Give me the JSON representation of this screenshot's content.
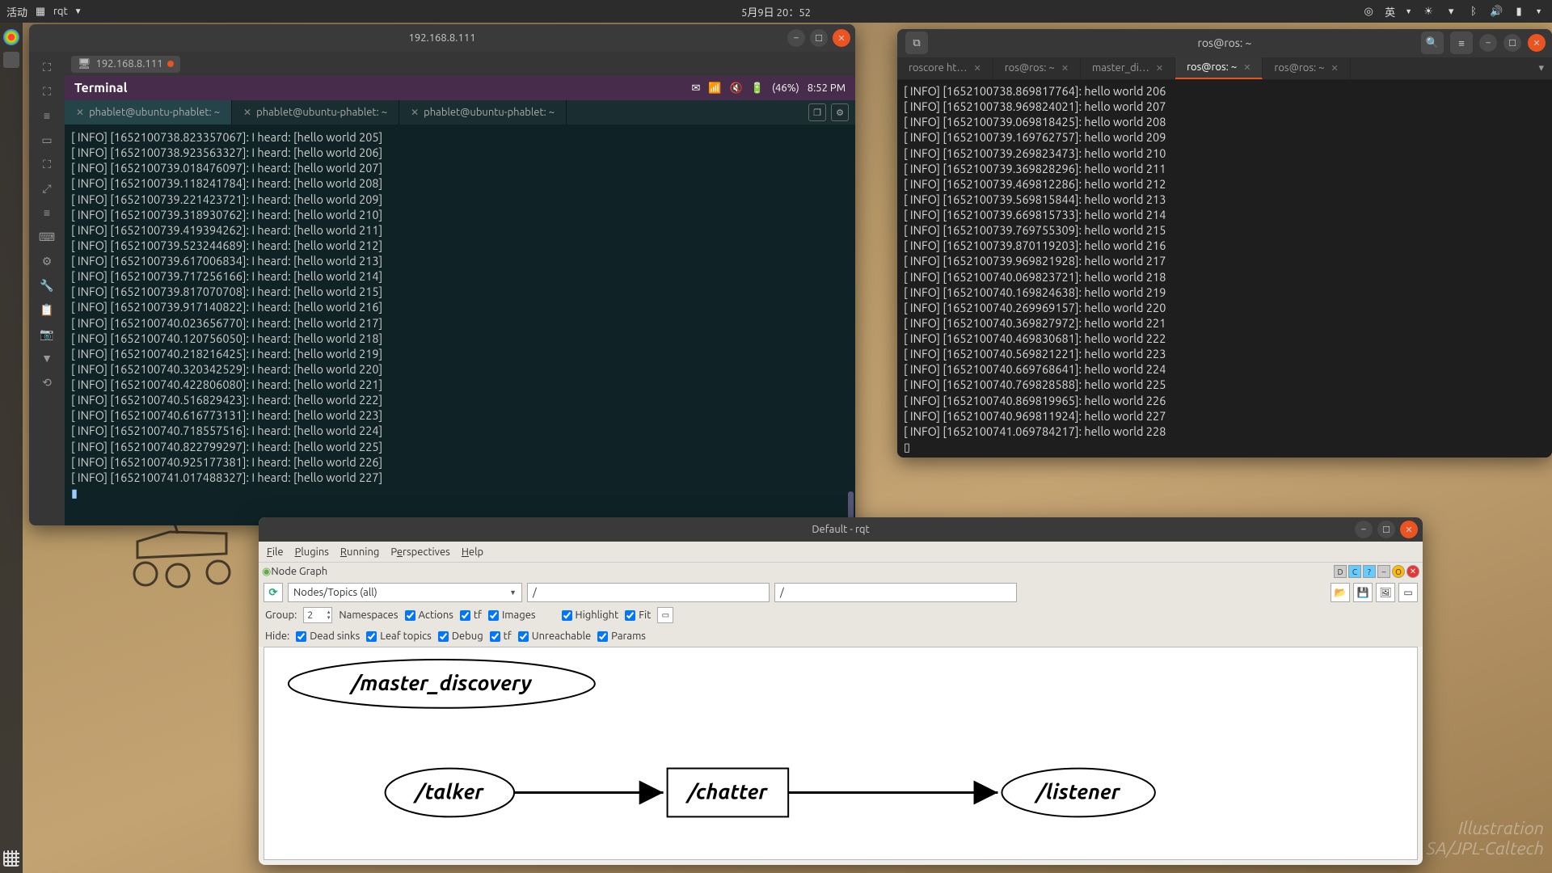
{
  "topbar": {
    "activities": "活动",
    "app": "rqt",
    "datetime": "5月9日 20：52",
    "lang": "英"
  },
  "dock_items": [
    "chrome",
    "google",
    "item3",
    "item4",
    "item5",
    "item6",
    "item7",
    "item8",
    "item9",
    "item10",
    "item11",
    "item12",
    "item13",
    "item14",
    "item15",
    "item16"
  ],
  "win1": {
    "title": "192.168.8.111",
    "tab_label": "192.168.8.111",
    "terminal_title": "Terminal",
    "battery": "(46%)",
    "time": "8:52 PM",
    "tabs": [
      "phablet@ubuntu-phablet: ~",
      "phablet@ubuntu-phablet: ~",
      "phablet@ubuntu-phablet: ~"
    ],
    "lines": [
      "[ INFO] [1652100738.823357067]: I heard: [hello world 205]",
      "[ INFO] [1652100738.923563327]: I heard: [hello world 206]",
      "[ INFO] [1652100739.018476097]: I heard: [hello world 207]",
      "[ INFO] [1652100739.118241784]: I heard: [hello world 208]",
      "[ INFO] [1652100739.221423721]: I heard: [hello world 209]",
      "[ INFO] [1652100739.318930762]: I heard: [hello world 210]",
      "[ INFO] [1652100739.419394262]: I heard: [hello world 211]",
      "[ INFO] [1652100739.523244689]: I heard: [hello world 212]",
      "[ INFO] [1652100739.617006834]: I heard: [hello world 213]",
      "[ INFO] [1652100739.717256166]: I heard: [hello world 214]",
      "[ INFO] [1652100739.817070708]: I heard: [hello world 215]",
      "[ INFO] [1652100739.917140822]: I heard: [hello world 216]",
      "[ INFO] [1652100740.023656770]: I heard: [hello world 217]",
      "[ INFO] [1652100740.120756050]: I heard: [hello world 218]",
      "[ INFO] [1652100740.218216425]: I heard: [hello world 219]",
      "[ INFO] [1652100740.320342529]: I heard: [hello world 220]",
      "[ INFO] [1652100740.422806080]: I heard: [hello world 221]",
      "[ INFO] [1652100740.516829423]: I heard: [hello world 222]",
      "[ INFO] [1652100740.616773131]: I heard: [hello world 223]",
      "[ INFO] [1652100740.718557516]: I heard: [hello world 224]",
      "[ INFO] [1652100740.822799297]: I heard: [hello world 225]",
      "[ INFO] [1652100740.925177381]: I heard: [hello world 226]",
      "[ INFO] [1652100741.017488327]: I heard: [hello world 227]"
    ]
  },
  "win2": {
    "title": "ros@ros: ~",
    "tabs": [
      "roscore ht…",
      "ros@ros: ~",
      "master_di…",
      "ros@ros: ~",
      "ros@ros: ~"
    ],
    "active_tab": 3,
    "lines": [
      "[ INFO] [1652100738.869817764]: hello world 206",
      "[ INFO] [1652100738.969824021]: hello world 207",
      "[ INFO] [1652100739.069818425]: hello world 208",
      "[ INFO] [1652100739.169762757]: hello world 209",
      "[ INFO] [1652100739.269823473]: hello world 210",
      "[ INFO] [1652100739.369828296]: hello world 211",
      "[ INFO] [1652100739.469812286]: hello world 212",
      "[ INFO] [1652100739.569815844]: hello world 213",
      "[ INFO] [1652100739.669815733]: hello world 214",
      "[ INFO] [1652100739.769755309]: hello world 215",
      "[ INFO] [1652100739.870119203]: hello world 216",
      "[ INFO] [1652100739.969821928]: hello world 217",
      "[ INFO] [1652100740.069823721]: hello world 218",
      "[ INFO] [1652100740.169824638]: hello world 219",
      "[ INFO] [1652100740.269969157]: hello world 220",
      "[ INFO] [1652100740.369827972]: hello world 221",
      "[ INFO] [1652100740.469830681]: hello world 222",
      "[ INFO] [1652100740.569821221]: hello world 223",
      "[ INFO] [1652100740.669768641]: hello world 224",
      "[ INFO] [1652100740.769828588]: hello world 225",
      "[ INFO] [1652100740.869819965]: hello world 226",
      "[ INFO] [1652100740.969811924]: hello world 227",
      "[ INFO] [1652100741.069784217]: hello world 228"
    ]
  },
  "win3": {
    "title": "Default - rqt",
    "menu": [
      "File",
      "Plugins",
      "Running",
      "Perspectives",
      "Help"
    ],
    "subtitle": "Node Graph",
    "combo": "Nodes/Topics (all)",
    "filter1": "/",
    "filter2": "/",
    "group_label": "Group:",
    "group_val": "2",
    "checks1": [
      "Namespaces",
      "Actions",
      "tf",
      "Images",
      "Highlight",
      "Fit"
    ],
    "hide_label": "Hide:",
    "checks2": [
      "Dead sinks",
      "Leaf topics",
      "Debug",
      "tf",
      "Unreachable",
      "Params"
    ],
    "nodes": {
      "a": "/master_discovery",
      "b": "/talker",
      "c": "/chatter",
      "d": "/listener"
    }
  },
  "watermark": {
    "a": "Illustration",
    "b": "SA/JPL-Caltech"
  }
}
